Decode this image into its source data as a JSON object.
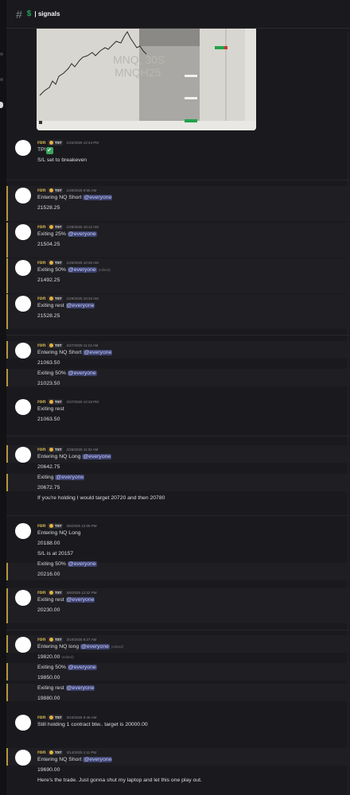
{
  "header": {
    "hash_icon": "#",
    "dollar_icon": "$",
    "title": "| signals"
  },
  "chart_image": {
    "watermark_line1": "MNQ, 30S",
    "watermark_line2": "MNQH25"
  },
  "messages": [
    {
      "time": "1/22/2025 12:44 PM",
      "lines": [
        {
          "text": "TP!",
          "check": true
        },
        {
          "text": "S/L set to breakeven"
        }
      ]
    },
    {
      "time": "1/29/2025 9:56 AM",
      "lines": [
        {
          "text": "Entering NQ Short",
          "mention": "@everyone"
        },
        {
          "text": "21528.25"
        }
      ]
    },
    {
      "time": "1/29/2025 10:12 AM",
      "lines": [
        {
          "text": "Exiting 25%",
          "mention": "@everyone"
        },
        {
          "text": "21504.25"
        }
      ]
    },
    {
      "time": "1/29/2025 10:26 AM",
      "lines": [
        {
          "text": "Exiting 50%",
          "mention": "@everyone",
          "edited": "(edited)"
        },
        {
          "text": "21492.25"
        }
      ]
    },
    {
      "time": "1/29/2025 10:34 AM",
      "lines": [
        {
          "text": "Exiting rest",
          "mention": "@everyone"
        },
        {
          "text": "21528.25"
        }
      ]
    },
    {
      "time": "2/27/2025 11:13 AM",
      "lines": [
        {
          "text": "Entering NQ Short",
          "mention": "@everyone"
        },
        {
          "text": "21063.50"
        },
        {
          "text": "Exiting 50%",
          "mention": "@everyone"
        },
        {
          "text": "21023.50"
        }
      ]
    },
    {
      "time": "2/27/2025 12:33 PM",
      "lines": [
        {
          "text": "Exiting rest"
        },
        {
          "text": "21063.50"
        }
      ]
    },
    {
      "time": "2/28/2025 11:32 AM",
      "lines": [
        {
          "text": "Entering NQ Long",
          "mention": "@everyone"
        },
        {
          "text": "20642.75"
        },
        {
          "text": "Exiting",
          "mention": "@everyone"
        },
        {
          "text": "20672.75"
        },
        {
          "text": "If you're holding I would target 20720 and then 20780"
        }
      ]
    },
    {
      "time": "3/6/2025 12:05 PM",
      "lines": [
        {
          "text": "Entering NQ Long"
        },
        {
          "text": "20188.00"
        },
        {
          "text": "S/L is at 20157"
        },
        {
          "text": "Exiting 50%",
          "mention": "@everyone"
        },
        {
          "text": "20216.00"
        }
      ]
    },
    {
      "time": "3/6/2025 12:22 PM",
      "lines": [
        {
          "text": "Exiting rest",
          "mention": "@everyone"
        },
        {
          "text": "20230.00"
        }
      ]
    },
    {
      "time": "3/10/2025 9:37 AM",
      "lines": [
        {
          "text": "Entering NQ long",
          "mention": "@everyone",
          "edited": "(edited)"
        },
        {
          "text": "19820.00",
          "edited": "(edited)"
        },
        {
          "text": "Exiting 50%",
          "mention": "@everyone"
        },
        {
          "text": "19850.00"
        },
        {
          "text": "Exiting rest",
          "mention": "@everyone"
        },
        {
          "text": "19880.00"
        }
      ]
    },
    {
      "time": "3/10/2025 9:46 AM",
      "lines": [
        {
          "text": "Still holding 1 contract btw.. target is 20000.00"
        }
      ]
    },
    {
      "time": "3/14/2025 1:11 PM",
      "lines": [
        {
          "text": "Entering NQ Short",
          "mention": "@everyone"
        },
        {
          "text": "19690.00"
        },
        {
          "text": "Here's the trade. Just gonna shut my laptop and let this one play out."
        }
      ]
    }
  ],
  "author": {
    "name": "ron",
    "tag": "TST",
    "badge_icon": "server-tag-icon"
  },
  "colors": {
    "background": "#1a1a1e",
    "author": "#dfc05a",
    "mention_bg": "#3c4270",
    "mention_text": "#c9cdfb",
    "highlight_bar": "#b5973f"
  }
}
